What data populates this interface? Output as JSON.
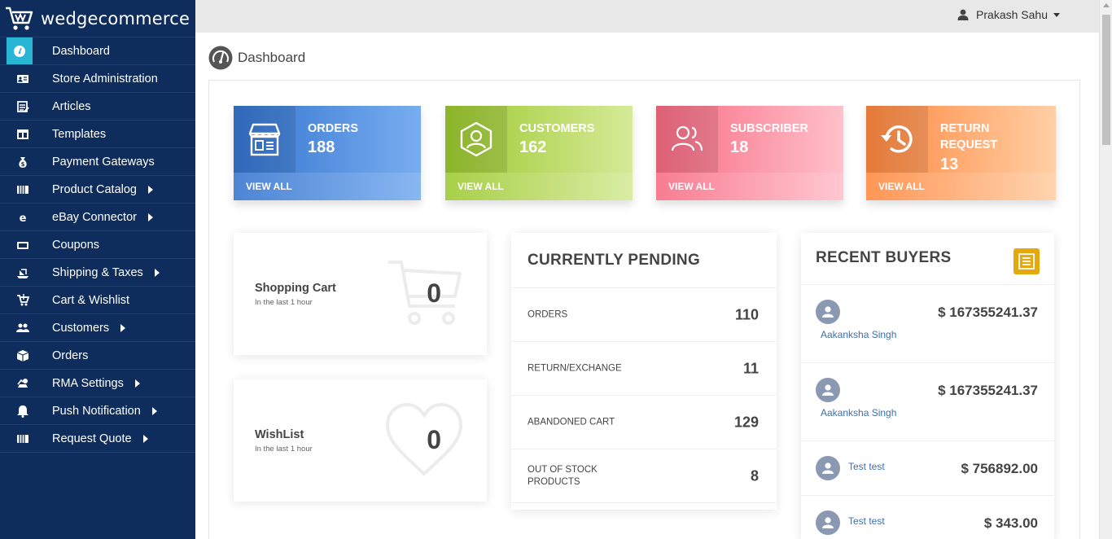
{
  "brand": {
    "name": "wedgecommerce"
  },
  "user": {
    "name": "Prakash Sahu"
  },
  "sidebar": {
    "items": [
      {
        "label": "Dashboard",
        "icon": "dashboard-icon",
        "active": true,
        "has_submenu": false
      },
      {
        "label": "Store Administration",
        "icon": "id-card-icon",
        "has_submenu": false
      },
      {
        "label": "Articles",
        "icon": "articles-icon",
        "has_submenu": false
      },
      {
        "label": "Templates",
        "icon": "templates-icon",
        "has_submenu": false
      },
      {
        "label": "Payment Gateways",
        "icon": "money-bag-icon",
        "has_submenu": false
      },
      {
        "label": "Product Catalog",
        "icon": "catalog-icon",
        "has_submenu": true
      },
      {
        "label": "eBay Connector",
        "icon": "ebay-icon",
        "has_submenu": true
      },
      {
        "label": "Coupons",
        "icon": "coupon-icon",
        "has_submenu": false
      },
      {
        "label": "Shipping & Taxes",
        "icon": "shipping-icon",
        "has_submenu": true
      },
      {
        "label": "Cart & Wishlist",
        "icon": "cart-icon",
        "has_submenu": false
      },
      {
        "label": "Customers",
        "icon": "users-icon",
        "has_submenu": true
      },
      {
        "label": "Orders",
        "icon": "box-icon",
        "has_submenu": false
      },
      {
        "label": "RMA Settings",
        "icon": "rma-icon",
        "has_submenu": true
      },
      {
        "label": "Push Notification",
        "icon": "bell-icon",
        "has_submenu": true
      },
      {
        "label": "Request Quote",
        "icon": "quote-icon",
        "has_submenu": true
      }
    ]
  },
  "page": {
    "title": "Dashboard"
  },
  "stats": {
    "orders": {
      "label": "ORDERS",
      "value": "188",
      "link": "VIEW ALL"
    },
    "customers": {
      "label": "CUSTOMERS",
      "value": "162",
      "link": "VIEW ALL"
    },
    "subscriber": {
      "label": "SUBSCRIBER",
      "value": "18",
      "link": "VIEW ALL"
    },
    "return_request": {
      "label_line1": "RETURN",
      "label_line2": "REQUEST",
      "value": "13",
      "link": "VIEW ALL"
    }
  },
  "shopping_cart": {
    "title": "Shopping Cart",
    "subtitle": "In the last 1 hour",
    "value": "0"
  },
  "wishlist": {
    "title": "WishList",
    "subtitle": "In the last 1 hour",
    "value": "0"
  },
  "pending": {
    "title": "CURRENTLY PENDING",
    "rows": [
      {
        "label": "ORDERS",
        "value": "110"
      },
      {
        "label": "RETURN/EXCHANGE",
        "value": "11"
      },
      {
        "label": "ABANDONED CART",
        "value": "129"
      },
      {
        "label": "OUT OF STOCK PRODUCTS",
        "value": "8"
      }
    ]
  },
  "recent_buyers": {
    "title": "RECENT BUYERS",
    "buyers": [
      {
        "name": "Aakanksha Singh",
        "amount": "$ 167355241.37"
      },
      {
        "name": "Aakanksha Singh",
        "amount": "$ 167355241.37"
      },
      {
        "name": "Test test",
        "amount": "$ 756892.00"
      },
      {
        "name": "Test test",
        "amount": "$ 343.00"
      }
    ]
  },
  "colors": {
    "sidebar_bg": "#0f2d5c",
    "active_accent": "#27b7d4",
    "orders": "#3575cf",
    "customers": "#9cc92f",
    "subscriber": "#f86b83",
    "return_request": "#ff8840",
    "buyers_button": "#e6a80f",
    "link": "#3a6fb0"
  }
}
